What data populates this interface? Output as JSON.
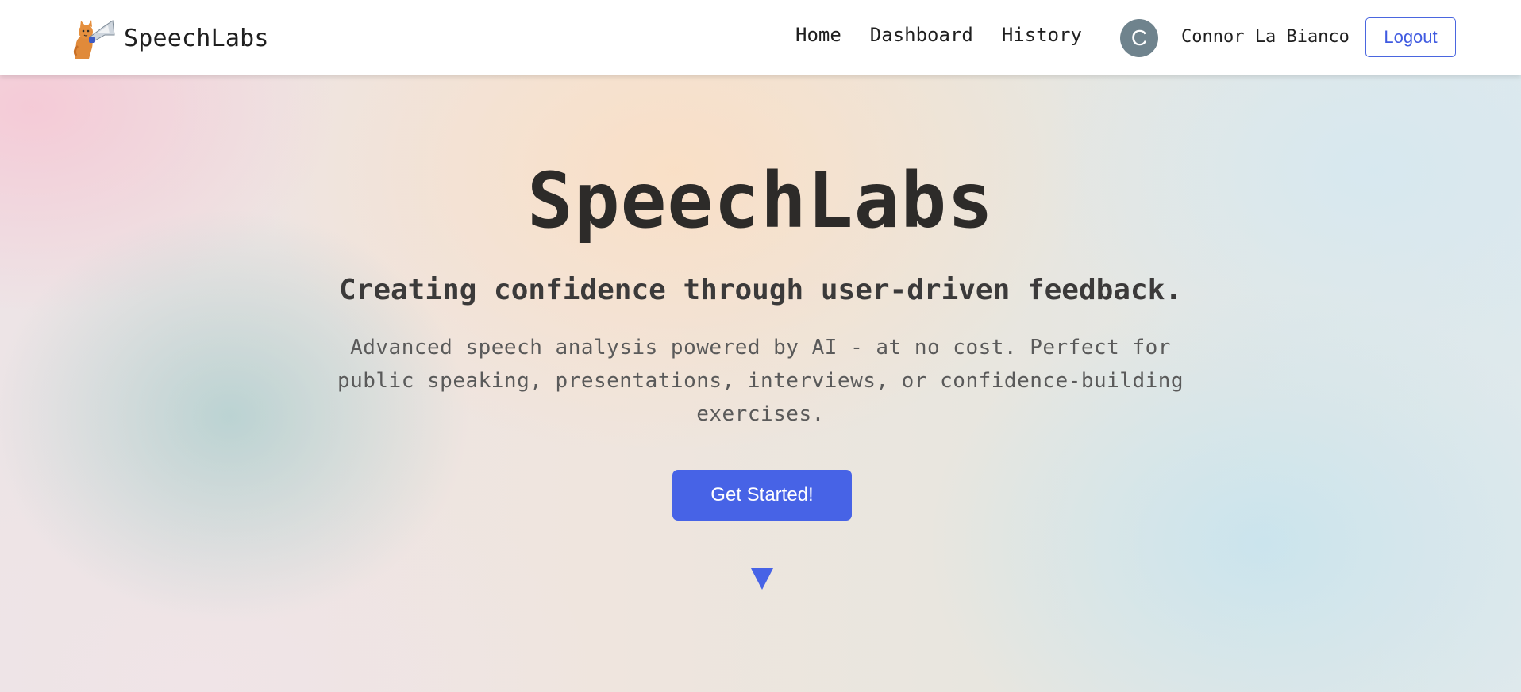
{
  "nav": {
    "brand": "SpeechLabs",
    "links": [
      {
        "label": "Home"
      },
      {
        "label": "Dashboard"
      },
      {
        "label": "History"
      }
    ],
    "user": {
      "avatar_initial": "C",
      "name": "Connor La Bianco"
    },
    "logout_label": "Logout"
  },
  "hero": {
    "title": "SpeechLabs",
    "subtitle": "Creating confidence through user-driven feedback.",
    "description": "Advanced speech analysis powered by AI - at no cost. Perfect for public speaking, presentations, interviews, or confidence-building exercises.",
    "cta_label": "Get Started!"
  },
  "icons": {
    "logo": "cat-megaphone-icon",
    "scroll": "triangle-down-icon"
  },
  "colors": {
    "accent": "#4763e6",
    "avatar": "#6f838d",
    "text_dark": "#2d2b29"
  }
}
